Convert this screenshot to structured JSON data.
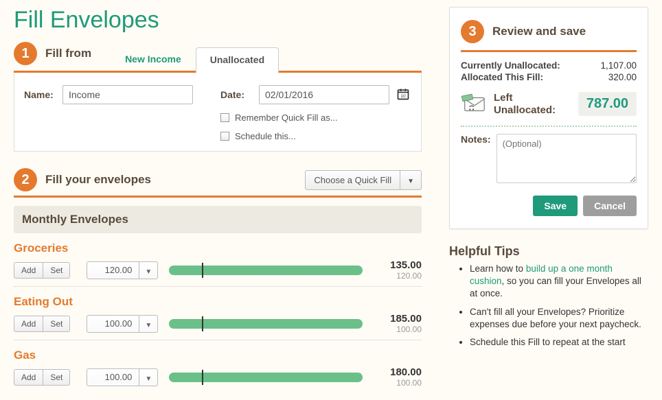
{
  "title": "Fill Envelopes",
  "step1": {
    "num": "1",
    "title": "Fill from",
    "tabs": {
      "new_income": "New Income",
      "unallocated": "Unallocated"
    },
    "name_label": "Name:",
    "name_value": "Income",
    "date_label": "Date:",
    "date_value": "02/01/2016",
    "remember_label": "Remember Quick Fill as...",
    "schedule_label": "Schedule this..."
  },
  "step2": {
    "num": "2",
    "title": "Fill your envelopes",
    "choose_label": "Choose a Quick Fill",
    "monthly_header": "Monthly Envelopes",
    "add_label": "Add",
    "set_label": "Set",
    "envelopes": [
      {
        "name": "Groceries",
        "input": "120.00",
        "balance": "135.00",
        "target": "120.00",
        "tick_pct": 17,
        "fill_pct": 100
      },
      {
        "name": "Eating Out",
        "input": "100.00",
        "balance": "185.00",
        "target": "100.00",
        "tick_pct": 17,
        "fill_pct": 100
      },
      {
        "name": "Gas",
        "input": "100.00",
        "balance": "180.00",
        "target": "100.00",
        "tick_pct": 17,
        "fill_pct": 100
      }
    ]
  },
  "step3": {
    "num": "3",
    "title": "Review and save",
    "unalloc_label": "Currently Unallocated:",
    "unalloc_val": "1,107.00",
    "alloc_label": "Allocated This Fill:",
    "alloc_val": "320.00",
    "left_label_1": "Left",
    "left_label_2": "Unallocated:",
    "left_val": "787.00",
    "notes_label": "Notes:",
    "notes_placeholder": "(Optional)",
    "save": "Save",
    "cancel": "Cancel"
  },
  "tips": {
    "title": "Helpful Tips",
    "items": [
      {
        "pre": "Learn how to ",
        "link": "build up a one month cushion",
        "post": ", so you can fill your Envelopes all at once."
      },
      {
        "pre": "Can't fill all your Envelopes? Prioritize expenses due before your next paycheck.",
        "link": "",
        "post": ""
      },
      {
        "pre": "Schedule this Fill to repeat at the start",
        "link": "",
        "post": ""
      }
    ]
  }
}
